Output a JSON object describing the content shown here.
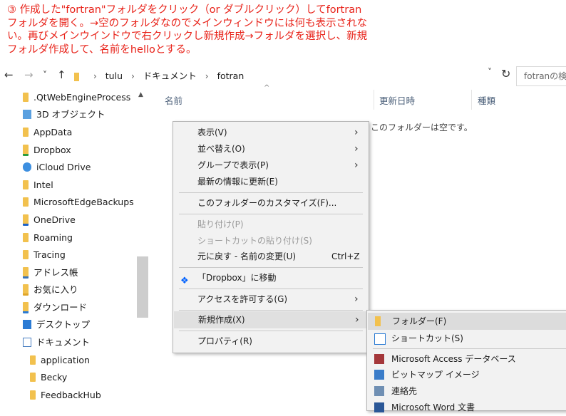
{
  "caption": "③ 作成した\"fortran\"フォルダをクリック（or ダブルクリック）してfortran\nフォルダを開く。→空のフォルダなのでメインウィンドウには何も表示されな\nい。再びメインウインドウで右クリックし新規作成→フォルダを選択し、新規\nフォルダ作成して、名前をhelloとする。",
  "nav": {
    "back": "←",
    "forward": "→",
    "recent": "˅",
    "up": "↑",
    "breadcrumb": [
      "tulu",
      "ドキュメント",
      "fotran"
    ],
    "refresh": "↻",
    "search_placeholder": "fotranの検索"
  },
  "sidebar": {
    "items": [
      {
        "label": ".QtWebEngineProcess",
        "icon": "folder-icon"
      },
      {
        "label": "3D オブジェクト",
        "icon": "3d-objects-icon"
      },
      {
        "label": "AppData",
        "icon": "folder-icon"
      },
      {
        "label": "Dropbox",
        "icon": "dropbox-icon"
      },
      {
        "label": "iCloud Drive",
        "icon": "icloud-icon"
      },
      {
        "label": "Intel",
        "icon": "folder-icon"
      },
      {
        "label": "MicrosoftEdgeBackups",
        "icon": "folder-icon"
      },
      {
        "label": "OneDrive",
        "icon": "onedrive-icon"
      },
      {
        "label": "Roaming",
        "icon": "folder-icon"
      },
      {
        "label": "Tracing",
        "icon": "folder-icon"
      },
      {
        "label": "アドレス帳",
        "icon": "contacts-icon"
      },
      {
        "label": "お気に入り",
        "icon": "favorites-icon"
      },
      {
        "label": "ダウンロード",
        "icon": "downloads-icon"
      },
      {
        "label": "デスクトップ",
        "icon": "desktop-icon"
      },
      {
        "label": "ドキュメント",
        "icon": "documents-icon"
      },
      {
        "label": "application",
        "icon": "folder-icon"
      },
      {
        "label": "Becky",
        "icon": "folder-icon"
      },
      {
        "label": "FeedbackHub",
        "icon": "folder-icon"
      }
    ]
  },
  "columns": {
    "name": "名前",
    "date": "更新日時",
    "type": "種類"
  },
  "empty_text": "このフォルダーは空です。",
  "context_menu": {
    "view": "表示(V)",
    "sort": "並べ替え(O)",
    "group": "グループで表示(P)",
    "refresh": "最新の情報に更新(E)",
    "customize": "このフォルダーのカスタマイズ(F)...",
    "paste": "貼り付け(P)",
    "paste_shortcut": "ショートカットの貼り付け(S)",
    "undo": "元に戻す - 名前の変更(U)",
    "undo_shortcut": "Ctrl+Z",
    "dropbox": "「Dropbox」に移動",
    "access": "アクセスを許可する(G)",
    "new": "新規作成(X)",
    "properties": "プロパティ(R)"
  },
  "submenu": {
    "folder": "フォルダー(F)",
    "shortcut": "ショートカット(S)",
    "access_db": "Microsoft Access データベース",
    "bitmap": "ビットマップ イメージ",
    "contact": "連絡先",
    "word": "Microsoft Word 文書"
  },
  "colors": {
    "caption": "#e8231a",
    "folder": "#f2c14e",
    "menu_bg": "#f2f2f2"
  }
}
